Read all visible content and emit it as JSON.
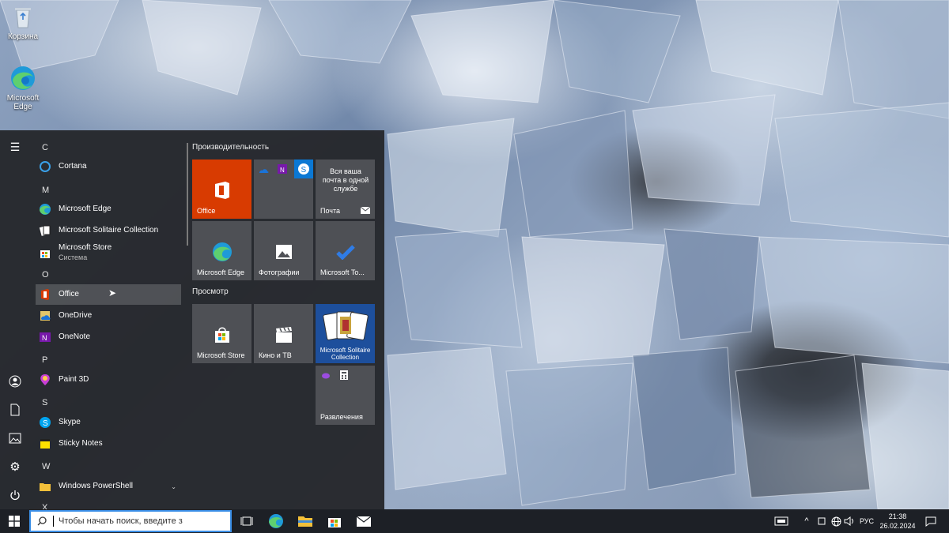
{
  "desktop": {
    "icons": [
      {
        "label": "Корзина"
      },
      {
        "label": "Microsoft Edge"
      }
    ]
  },
  "start_menu": {
    "app_list": {
      "letters": [
        "C",
        "M",
        "O",
        "P",
        "S",
        "W",
        "X"
      ],
      "items": [
        {
          "label": "Cortana",
          "sub": ""
        },
        {
          "label": "Microsoft Edge",
          "sub": ""
        },
        {
          "label": "Microsoft Solitaire Collection",
          "sub": ""
        },
        {
          "label": "Microsoft Store",
          "sub": "Система"
        },
        {
          "label": "Office",
          "sub": ""
        },
        {
          "label": "OneDrive",
          "sub": ""
        },
        {
          "label": "OneNote",
          "sub": ""
        },
        {
          "label": "Paint 3D",
          "sub": ""
        },
        {
          "label": "Skype",
          "sub": ""
        },
        {
          "label": "Sticky Notes",
          "sub": ""
        },
        {
          "label": "Windows PowerShell",
          "sub": ""
        }
      ]
    },
    "tile_groups": [
      {
        "title": "Производительность",
        "tiles": [
          {
            "label": "Office"
          },
          {
            "label": ""
          },
          {
            "label": "Почта",
            "text": "Вся ваша почта в одной службе"
          },
          {
            "label": "Microsoft Edge"
          },
          {
            "label": "Фотографии"
          },
          {
            "label": "Microsoft To..."
          }
        ]
      },
      {
        "title": "Просмотр",
        "tiles": [
          {
            "label": "Microsoft Store"
          },
          {
            "label": "Кино и ТВ"
          },
          {
            "label": "Microsoft Solitaire Collection"
          },
          {
            "label": "Развлечения"
          }
        ]
      }
    ]
  },
  "taskbar": {
    "search_placeholder": "Чтобы начать поиск, введите з",
    "language": "РУС",
    "time": "21:38",
    "date": "26.02.2024"
  },
  "colors": {
    "office_tile": "#d83b01",
    "solitaire_tile": "#1d4f9c",
    "search_border": "#3a8ee6"
  }
}
